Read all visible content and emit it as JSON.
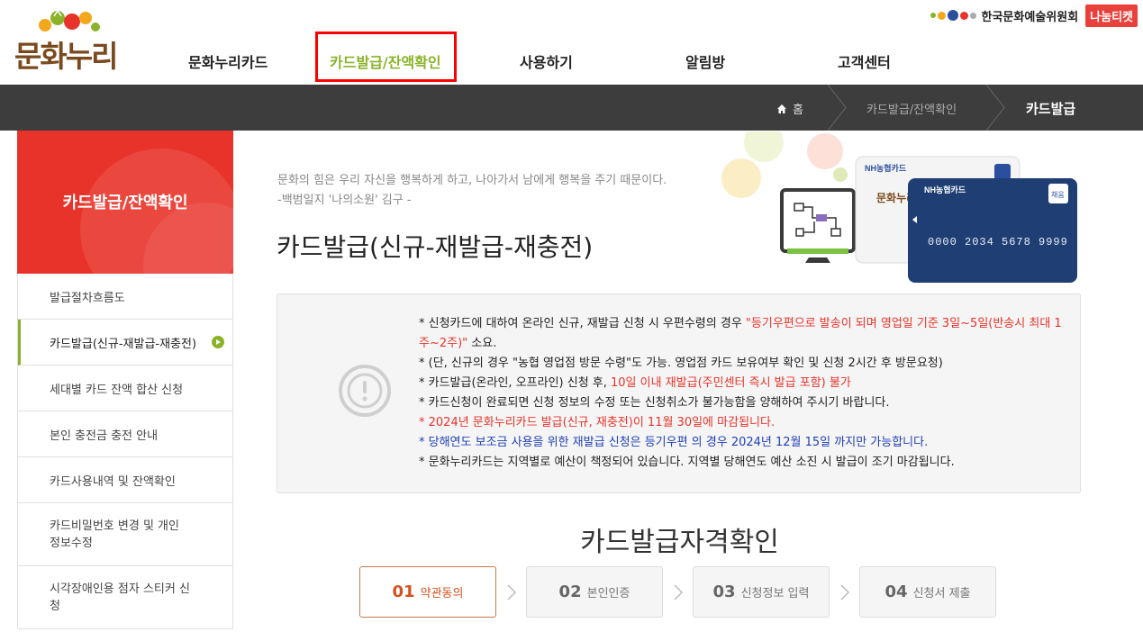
{
  "brand": {
    "logo_text": "문화누리"
  },
  "top_util": {
    "arko_label": "한국문화예술위원회",
    "nanum_label": "나눔티켓"
  },
  "gnb": {
    "items": [
      {
        "label": "문화누리카드"
      },
      {
        "label": "카드발급/잔액확인",
        "active": true
      },
      {
        "label": "사용하기"
      },
      {
        "label": "알림방"
      },
      {
        "label": "고객센터"
      }
    ]
  },
  "breadcrumb": {
    "home": "홈",
    "parent": "카드발급/잔액확인",
    "current": "카드발급"
  },
  "sidebar": {
    "title": "카드발급/잔액확인",
    "items": [
      {
        "label": "발급절차흐름도"
      },
      {
        "label": "카드발급(신규-재발급-재충전)",
        "active": true
      },
      {
        "label": "세대별 카드 잔액 합산 신청"
      },
      {
        "label": "본인 충전금 충전 안내"
      },
      {
        "label": "카드사용내역 및 잔액확인"
      },
      {
        "label": "카드비밀번호 변경 및 개인 정보수정"
      },
      {
        "label": "시각장애인용 점자 스티커 신청"
      }
    ]
  },
  "quote": {
    "line1": "문화의 힘은 우리 자신을 행복하게 하고, 나아가서 남에게 행복을 주기 때문이다.",
    "line2": "-백범일지 '나의소원' 김구 -"
  },
  "page_title": "카드발급(신규-재발급-재충전)",
  "cards": {
    "card1_brand": "NH농협카드",
    "card2_brand": "NH농협카드",
    "card_badge": "채움",
    "card_number": "0000 2034 5678 9999",
    "card_logo": "문화누리"
  },
  "notice": {
    "l1a": "* 신청카드에 대하여 온라인 신규, 재발급 신청 시 우편수령의 경우 ",
    "l1b": "\"등기우편으로 발송이 되며 영업일 기준 3일~5일(반송시 최대 1주~2주)\"",
    "l1c": " 소요.",
    "l2": "* (단, 신규의 경우 \"농협 영업점 방문 수령\"도 가능. 영업점 카드 보유여부 확인 및 신청 2시간 후 방문요청)",
    "l3a": "* 카드발급(온라인, 오프라인) 신청 후, ",
    "l3b": "10일 이내 재발급(주민센터 즉시 발급 포함) 불가",
    "l4": "* 카드신청이 완료되면 신청 정보의 수정 또는 신청취소가 불가능함을 양해하여 주시기 바랍니다.",
    "l5": "* 2024년 문화누리카드 발급(신규, 재충전)이 11월 30일에 마감됩니다.",
    "l6": "* 당해연도 보조금 사용을 위한 재발급 신청은 등기우편 의 경우 2024년 12월 15일 까지만 가능합니다.",
    "l7": "* 문화누리카드는 지역별로 예산이 책정되어 있습니다. 지역별 당해연도 예산 소진 시 발급이 조기 마감됩니다."
  },
  "section_title": "카드발급자격확인",
  "steps": [
    {
      "num": "01",
      "label": "약관동의",
      "active": true
    },
    {
      "num": "02",
      "label": "본인인증"
    },
    {
      "num": "03",
      "label": "신청정보 입력"
    },
    {
      "num": "04",
      "label": "신청서 제출"
    }
  ],
  "colors": {
    "accent_green": "#8ab329",
    "sidebar_red": "#e8332a",
    "loc_bar": "#3d3d3d",
    "step_active": "#d2521f"
  }
}
